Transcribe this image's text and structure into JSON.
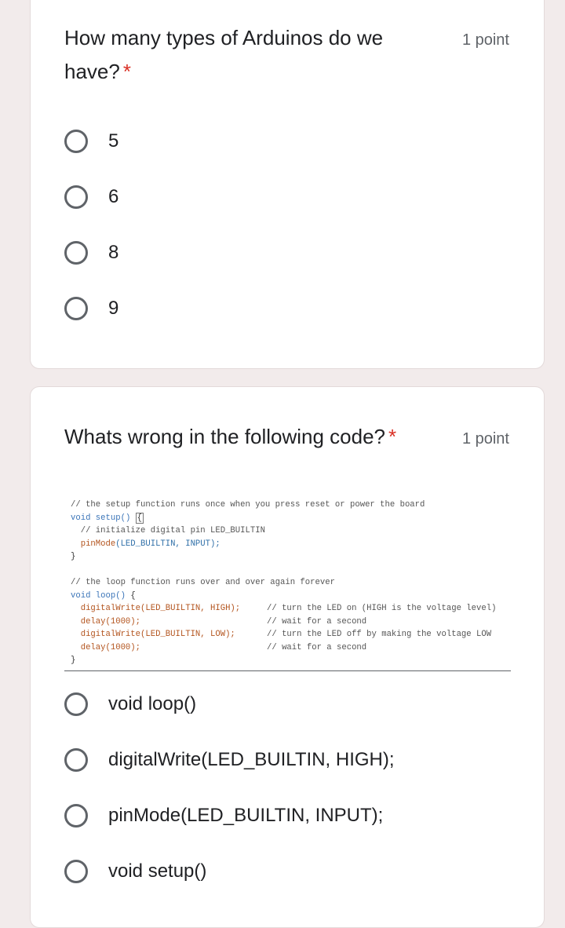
{
  "questions": [
    {
      "title": "How many types of Arduinos do we have?",
      "required_mark": "*",
      "points": "1 point",
      "options": [
        "5",
        "6",
        "8",
        "9"
      ]
    },
    {
      "title": "Whats wrong in the following code?",
      "required_mark": "*",
      "points": "1 point",
      "code": {
        "l1": "// the setup function runs once when you press reset or power the board",
        "l2_kw": "void",
        "l2_fn": "setup()",
        "l2_brace": "{",
        "l3": "  // initialize digital pin LED_BUILTIN",
        "l4_fn": "  pinMode",
        "l4_args": "(LED_BUILTIN, INPUT);",
        "l5": "}",
        "l7": "// the loop function runs over and over again forever",
        "l8_kw": "void",
        "l8_fn": "loop()",
        "l8_brace": "{",
        "l9_code": "  digitalWrite(LED_BUILTIN, HIGH);",
        "l9_cmt": "// turn the LED on (HIGH is the voltage level)",
        "l10_code": "  delay(1000);",
        "l10_cmt": "// wait for a second",
        "l11_code": "  digitalWrite(LED_BUILTIN, LOW);",
        "l11_cmt": "// turn the LED off by making the voltage LOW",
        "l12_code": "  delay(1000);",
        "l12_cmt": "// wait for a second",
        "l13": "}"
      },
      "options": [
        "void loop()",
        "digitalWrite(LED_BUILTIN, HIGH);",
        "pinMode(LED_BUILTIN, INPUT);",
        "void setup()"
      ]
    }
  ],
  "colors": {
    "background": "#f2ebeb",
    "card": "#ffffff",
    "required": "#d93025",
    "radio": "#5f6368"
  }
}
